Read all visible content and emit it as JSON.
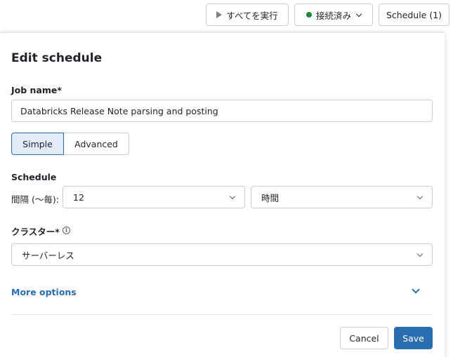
{
  "toolbar": {
    "run_all_label": "すべてを実行",
    "connected_label": "接続済み",
    "schedule_label": "Schedule (1)",
    "status_color": "#1f8a3f"
  },
  "panel": {
    "title": "Edit schedule",
    "job_name_label": "Job name*",
    "job_name_value": "Databricks Release Note parsing and posting",
    "mode_tabs": {
      "simple": "Simple",
      "advanced": "Advanced",
      "selected": "Simple"
    },
    "schedule_label": "Schedule",
    "interval_label": "間隔 (〜毎):",
    "interval_value": "12",
    "interval_unit": "時間",
    "cluster_label": "クラスター*",
    "cluster_value": "サーバーレス",
    "more_options_label": "More options",
    "cancel_label": "Cancel",
    "save_label": "Save",
    "accent_color": "#2a6db0"
  }
}
